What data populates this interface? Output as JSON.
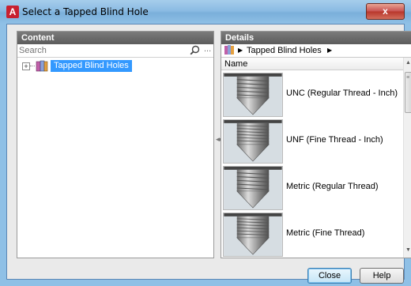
{
  "window": {
    "title": "Select a Tapped Blind Hole",
    "app_icon": "autocad-icon",
    "close_label": "x"
  },
  "content": {
    "header": "Content",
    "search_placeholder": "Search",
    "more_label": "...",
    "tree": [
      {
        "label": "Tapped Blind Holes",
        "expander": "+",
        "icon": "folder-icon"
      }
    ]
  },
  "details": {
    "header": "Details",
    "breadcrumb": "Tapped Blind Holes",
    "column": "Name",
    "items": [
      {
        "label": "UNC (Regular Thread - Inch)"
      },
      {
        "label": "UNF (Fine Thread - Inch)"
      },
      {
        "label": "Metric (Regular Thread)"
      },
      {
        "label": "Metric (Fine Thread)"
      }
    ]
  },
  "footer": {
    "close_label": "Close",
    "help_label": "Help"
  },
  "colors": {
    "selection": "#3399ff",
    "panel_header": "#6b6b6b",
    "accent": "#c8202f"
  }
}
